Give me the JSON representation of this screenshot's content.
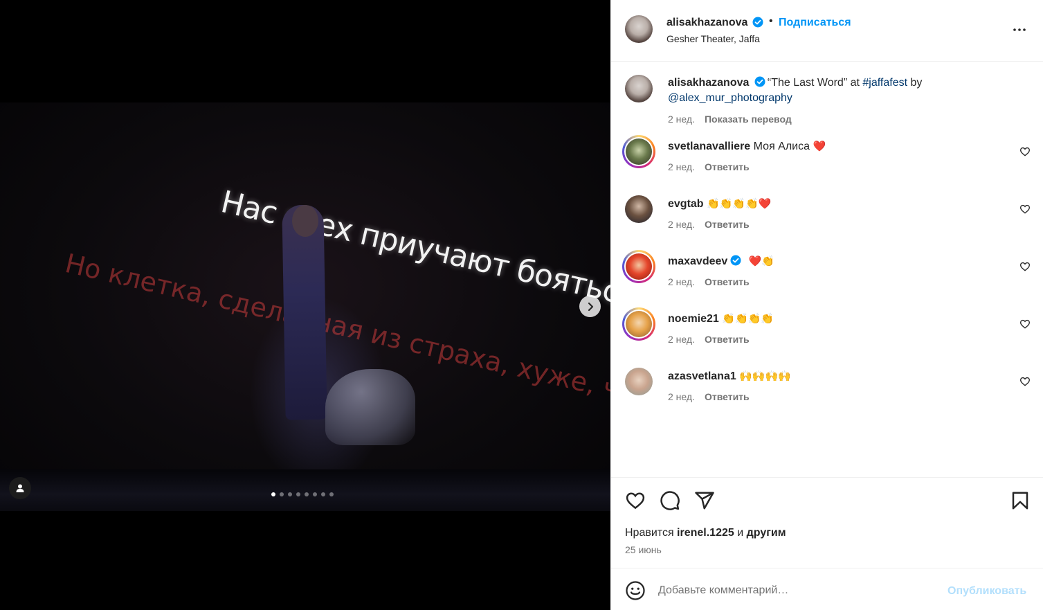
{
  "media": {
    "overlay_line1": "Нас всех приучают бояться.",
    "overlay_line2": "Но клетка, сделанная из страха, хуже, чем клетка",
    "slide_count": 8,
    "active_slide": 1
  },
  "post": {
    "author": "alisakhazanova",
    "follow_label": "Подписаться",
    "separator": "•",
    "location": "Gesher Theater, Jaffa",
    "caption_prefix": "“The Last Word” at ",
    "caption_hashtag": "#jaffafest",
    "caption_by": " by",
    "caption_mention": "@alex_mur_photography",
    "caption_time": "2 нед.",
    "caption_translate": "Показать перевод"
  },
  "comments": [
    {
      "user": "svetlanavalliere",
      "text": "Моя Алиса",
      "emoji": "❤️",
      "time": "2 нед.",
      "reply": "Ответить"
    },
    {
      "user": "evgtab",
      "text": "",
      "emoji": "👏👏👏👏❤️",
      "time": "2 нед.",
      "reply": "Ответить"
    },
    {
      "user": "maxavdeev",
      "text": "",
      "emoji": "❤️👏",
      "time": "2 нед.",
      "reply": "Ответить"
    },
    {
      "user": "noemie21",
      "text": "",
      "emoji": "👏👏👏👏",
      "time": "2 нед.",
      "reply": "Ответить"
    },
    {
      "user": "azasvetlana1",
      "text": "",
      "emoji": "🙌🙌🙌🙌",
      "time": "2 нед.",
      "reply": "Ответить"
    }
  ],
  "likes": {
    "prefix": "Нравится ",
    "user": "irenel.1225",
    "middle": " и ",
    "others": "другим"
  },
  "date": "25 июнь",
  "composer": {
    "placeholder": "Добавьте комментарий…",
    "post_label": "Опубликовать"
  },
  "colors": {
    "accent": "#0095f6",
    "link": "#00376b",
    "muted": "#737373",
    "heart_red": "#ed4956"
  },
  "icons": [
    "more-icon",
    "verified-icon",
    "heart-icon",
    "comment-icon",
    "share-icon",
    "bookmark-icon",
    "emoji-icon",
    "chevron-right-icon",
    "user-tag-icon"
  ]
}
